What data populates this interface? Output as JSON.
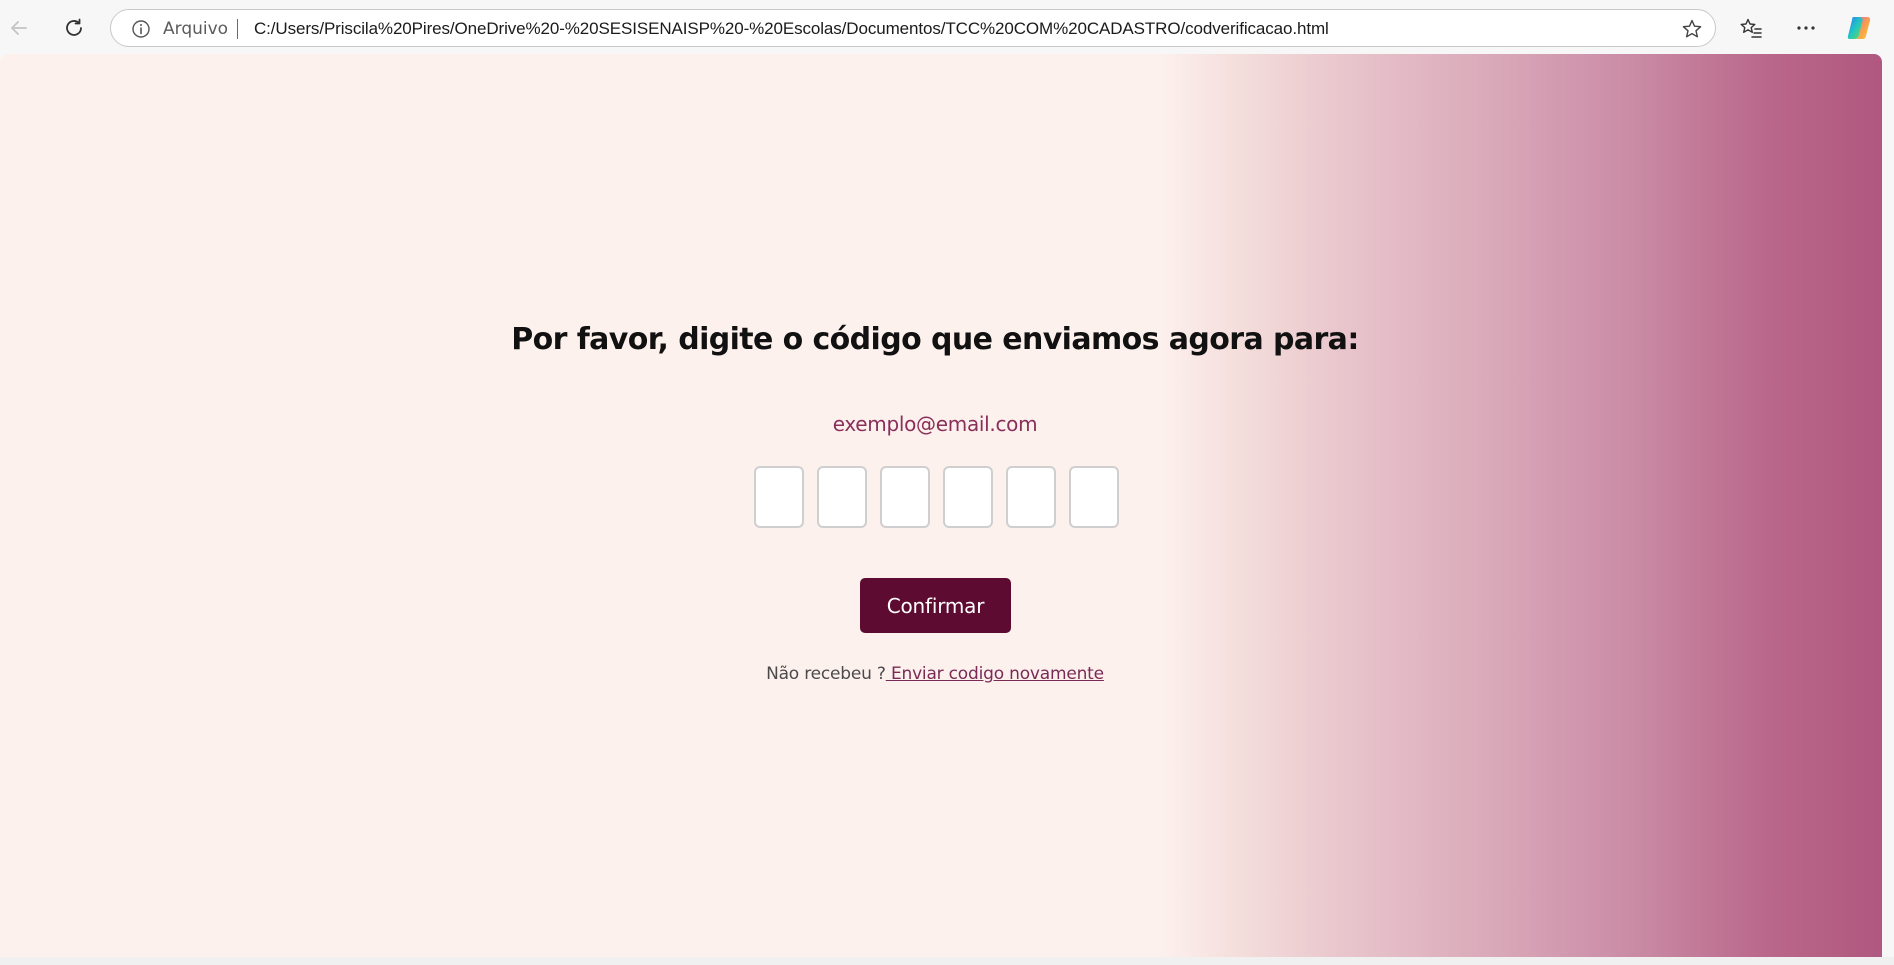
{
  "browser": {
    "scheme_label": "Arquivo",
    "url": "C:/Users/Priscila%20Pires/OneDrive%20-%20SESISENAISP%20-%20Escolas/Documentos/TCC%20COM%20CADASTRO/codverificacao.html",
    "icons": [
      "back-arrow-icon",
      "refresh-icon",
      "info-icon",
      "star-icon",
      "favorites-icon",
      "more-icon",
      "copilot-icon"
    ]
  },
  "page": {
    "heading": "Por favor, digite o código que enviamos agora para:",
    "email": "exemplo@email.com",
    "code_inputs": [
      "",
      "",
      "",
      "",
      "",
      ""
    ],
    "confirm_label": "Confirmar",
    "resend_prompt": "Não recebeu ?",
    "resend_link": " Enviar codigo novamente",
    "colors": {
      "button": "#5e0b32",
      "email": "#8a2e5a",
      "background_light": "#fdf1ee",
      "background_dark": "#b0587f"
    }
  }
}
